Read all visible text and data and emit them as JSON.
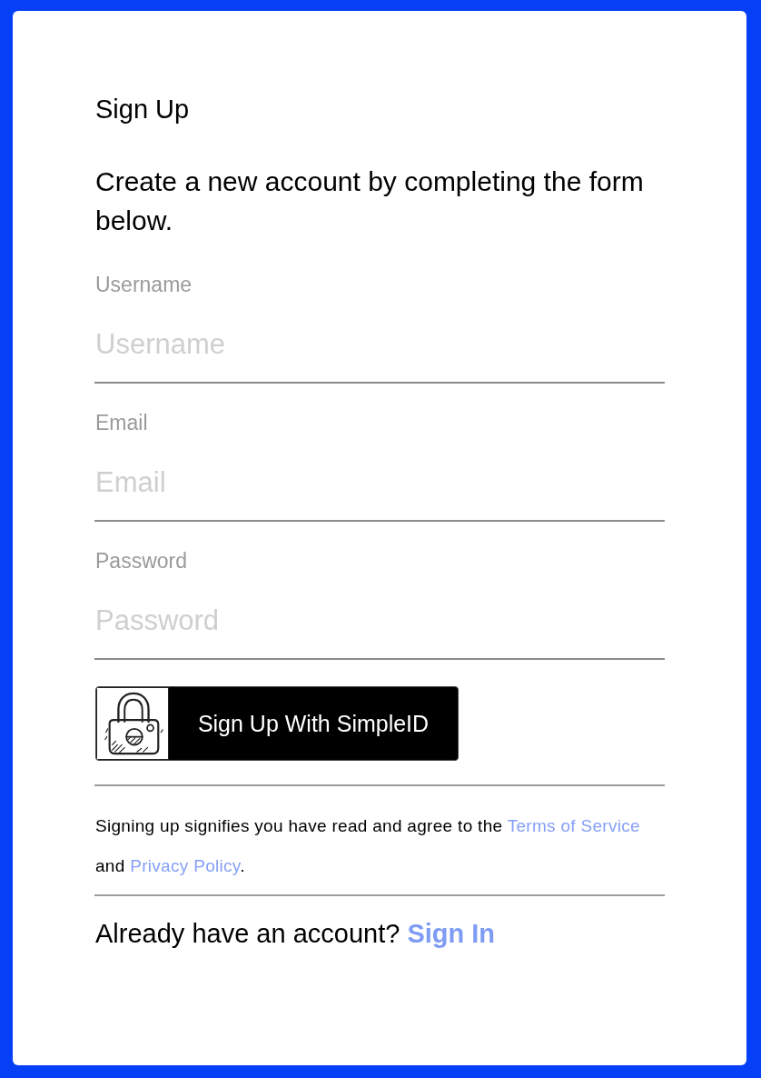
{
  "form": {
    "title": "Sign Up",
    "intro": "Create a new account by completing the form below."
  },
  "fields": [
    {
      "label": "Username",
      "placeholder": "Username"
    },
    {
      "label": "Email",
      "placeholder": "Email"
    },
    {
      "label": "Password",
      "placeholder": "Password"
    }
  ],
  "simpleid_button": {
    "label": "Sign Up With SimpleID"
  },
  "terms": [
    {
      "kind": "text",
      "text": "Signing up signifies you have read and agree to the "
    },
    {
      "kind": "link",
      "text": "Terms of Service"
    },
    {
      "kind": "text",
      "text": " and "
    },
    {
      "kind": "link",
      "text": "Privacy Policy"
    },
    {
      "kind": "text",
      "text": "."
    }
  ],
  "signin": [
    {
      "kind": "text",
      "text": "Already have an account? "
    },
    {
      "kind": "link",
      "text": "Sign In"
    }
  ]
}
